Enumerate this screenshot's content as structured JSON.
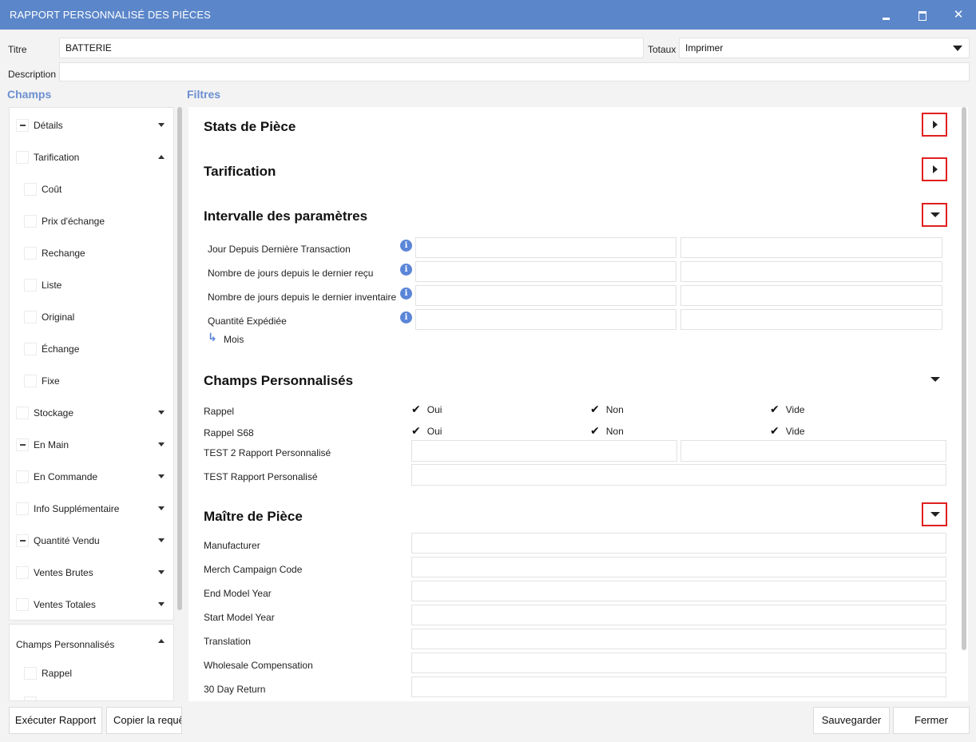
{
  "window": {
    "title": "RAPPORT PERSONNALISÉ DES PIÈCES",
    "close_glyph": "✕"
  },
  "header": {
    "titre_label": "Titre",
    "titre_value": "BATTERIE",
    "totaux_label": "Totaux",
    "totaux_value": "Imprimer",
    "description_label": "Description",
    "description_value": ""
  },
  "sections": {
    "champs": "Champs",
    "filtres": "Filtres"
  },
  "fields_tree": [
    {
      "label": "Détails",
      "state": "partial",
      "indent": 0,
      "expander": "down"
    },
    {
      "label": "Tarification",
      "state": "unchecked",
      "indent": 0,
      "expander": "up"
    },
    {
      "label": "Coût",
      "state": "unchecked",
      "indent": 1,
      "expander": ""
    },
    {
      "label": "Prix d'échange",
      "state": "unchecked",
      "indent": 1,
      "expander": ""
    },
    {
      "label": "Rechange",
      "state": "unchecked",
      "indent": 1,
      "expander": ""
    },
    {
      "label": "Liste",
      "state": "unchecked",
      "indent": 1,
      "expander": ""
    },
    {
      "label": "Original",
      "state": "unchecked",
      "indent": 1,
      "expander": ""
    },
    {
      "label": "Échange",
      "state": "unchecked",
      "indent": 1,
      "expander": ""
    },
    {
      "label": "Fixe",
      "state": "unchecked",
      "indent": 1,
      "expander": ""
    },
    {
      "label": "Stockage",
      "state": "unchecked",
      "indent": 0,
      "expander": "down"
    },
    {
      "label": "En Main",
      "state": "partial",
      "indent": 0,
      "expander": "down"
    },
    {
      "label": "En Commande",
      "state": "unchecked",
      "indent": 0,
      "expander": "down"
    },
    {
      "label": "Info Supplémentaire",
      "state": "unchecked",
      "indent": 0,
      "expander": "down"
    },
    {
      "label": "Quantité Vendu",
      "state": "partial",
      "indent": 0,
      "expander": "down"
    },
    {
      "label": "Ventes Brutes",
      "state": "unchecked",
      "indent": 0,
      "expander": "down"
    },
    {
      "label": "Ventes Totales",
      "state": "unchecked",
      "indent": 0,
      "expander": "down"
    }
  ],
  "custom_fields_tree": {
    "title": "Champs Personnalisés",
    "items": [
      "Rappel"
    ]
  },
  "filters": {
    "stats_title": "Stats de Pièce",
    "tarification_title": "Tarification",
    "intervalle_title": "Intervalle des paramètres",
    "intervalle_rows": [
      "Jour Depuis Dernière Transaction",
      "Nombre de jours depuis le dernier reçu",
      "Nombre de jours depuis le dernier inventaire",
      "Quantité Expédiée"
    ],
    "sub_label": "Mois",
    "sub_arrow": "↳",
    "info_glyph": "i",
    "custom_title": "Champs Personnalisés",
    "check_glyph": "✔",
    "custom_rows": [
      {
        "label": "Rappel",
        "options": [
          "Oui",
          "Non",
          "Vide"
        ]
      },
      {
        "label": "Rappel S68",
        "options": [
          "Oui",
          "Non",
          "Vide"
        ]
      }
    ],
    "custom_text_rows": [
      "TEST 2 Rapport Personnalisé",
      "TEST Rapport Personalisé"
    ],
    "master_title": "Maître de Pièce",
    "master_rows": [
      "Manufacturer",
      "Merch Campaign Code",
      "End Model Year",
      "Start Model Year",
      "Translation",
      "Wholesale Compensation",
      "30 Day Return"
    ]
  },
  "footer": {
    "run_label": "Exécuter Rapport",
    "copy_label": "Copier la requête",
    "save_label": "Sauvegarder",
    "close_label": "Fermer"
  }
}
